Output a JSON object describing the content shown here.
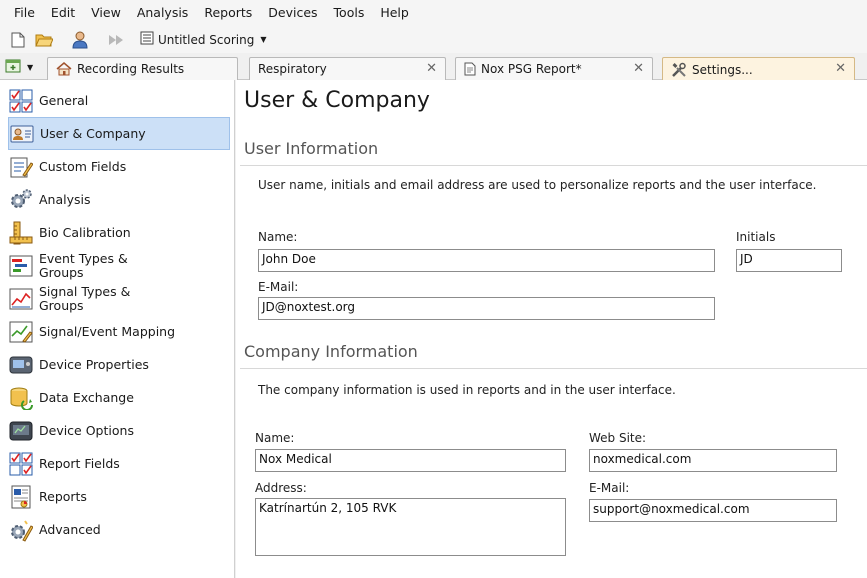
{
  "menu": [
    "File",
    "Edit",
    "View",
    "Analysis",
    "Reports",
    "Devices",
    "Tools",
    "Help"
  ],
  "toolbar": {
    "scoring_label": "Untitled Scoring"
  },
  "tabs": [
    {
      "label": "Recording Results"
    },
    {
      "label": "Respiratory"
    },
    {
      "label": "Nox PSG Report*"
    },
    {
      "label": "Settings..."
    }
  ],
  "sidebar": {
    "items": [
      {
        "label": "General",
        "icon": "checklist-icon"
      },
      {
        "label": "User & Company",
        "icon": "user-card-icon"
      },
      {
        "label": "Custom Fields",
        "icon": "form-pencil-icon"
      },
      {
        "label": "Analysis",
        "icon": "gears-icon"
      },
      {
        "label": "Bio Calibration",
        "icon": "ruler-icon"
      },
      {
        "label": "Event Types &",
        "label2": "Groups",
        "icon": "event-types-icon"
      },
      {
        "label": "Signal Types &",
        "label2": "Groups",
        "icon": "signal-chart-icon"
      },
      {
        "label": "Signal/Event Mapping",
        "icon": "mapping-icon"
      },
      {
        "label": "Device Properties",
        "icon": "device-icon"
      },
      {
        "label": "Data Exchange",
        "icon": "database-icon"
      },
      {
        "label": "Device Options",
        "icon": "device-options-icon"
      },
      {
        "label": "Report Fields",
        "icon": "report-fields-icon"
      },
      {
        "label": "Reports",
        "icon": "report-icon"
      },
      {
        "label": "Advanced",
        "icon": "advanced-gear-icon"
      }
    ]
  },
  "main": {
    "title": "User & Company",
    "user_info": {
      "heading": "User Information",
      "description": "User name, initials and email address are used to personalize reports and the user interface.",
      "name_label": "Name:",
      "name_value": "John Doe",
      "initials_label": "Initials",
      "initials_value": "JD",
      "email_label": "E-Mail:",
      "email_value": "JD@noxtest.org"
    },
    "company_info": {
      "heading": "Company Information",
      "description": "The company information is used in reports and in the user interface.",
      "name_label": "Name:",
      "name_value": "Nox Medical",
      "website_label": "Web Site:",
      "website_value": "noxmedical.com",
      "address_label": "Address:",
      "address_value": "Katrínartún 2, 105 RVK",
      "email_label": "E-Mail:",
      "email_value": "support@noxmedical.com"
    }
  }
}
